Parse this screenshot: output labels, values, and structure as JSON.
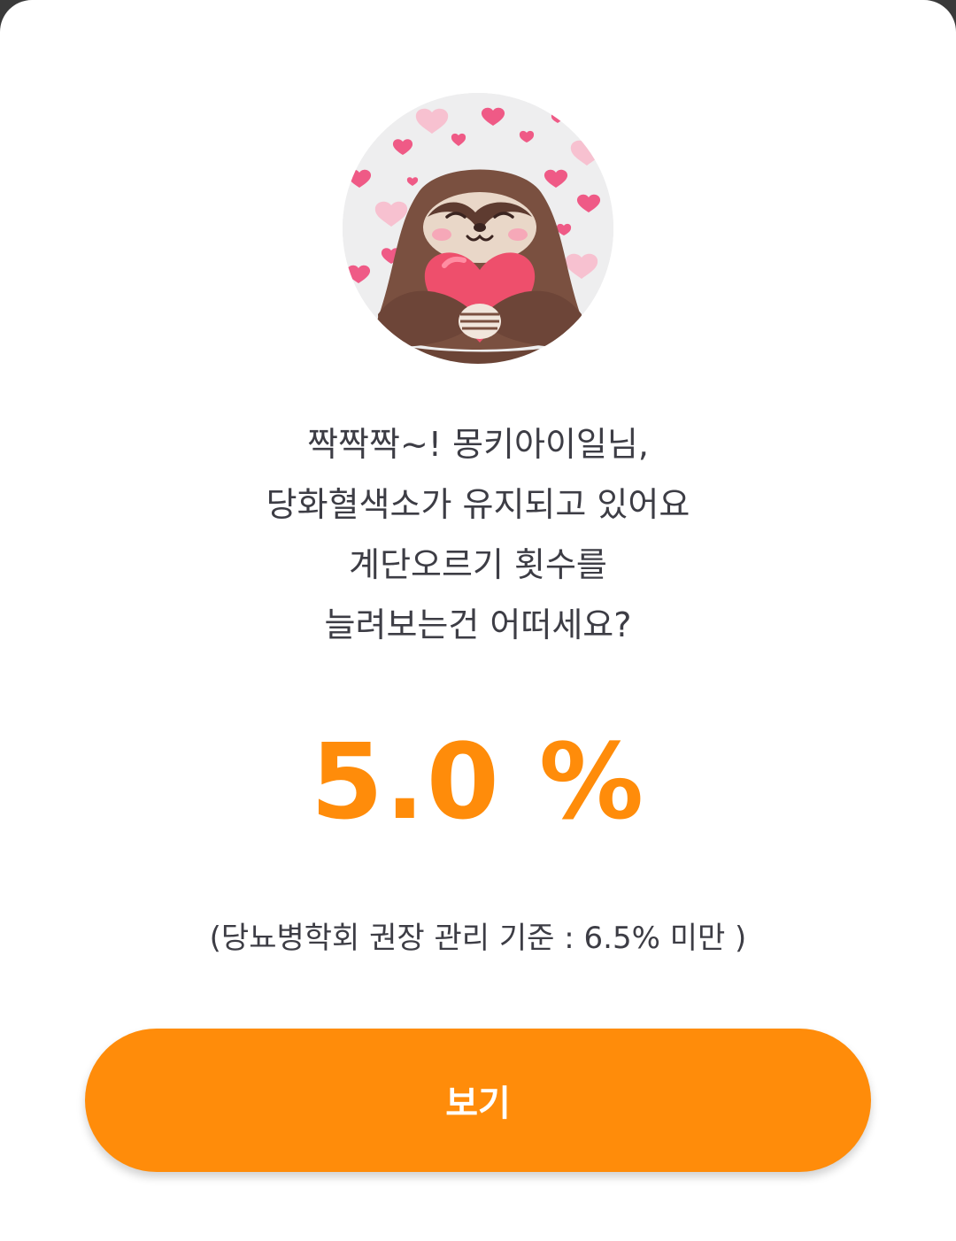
{
  "illustration": {
    "name": "sloth-hugging-heart-illustration"
  },
  "message": {
    "line1": "짝짝짝~! 몽키아이일님,",
    "line2": "당화혈색소가 유지되고 있어요",
    "line3": "계단오르기 횟수를",
    "line4": "늘려보는건 어떠세요?"
  },
  "result": {
    "value": "5.0 %"
  },
  "criteria": {
    "text": "(당뇨병학회 권장 관리 기준 : 6.5% 미만 )"
  },
  "button": {
    "label": "보기"
  },
  "colors": {
    "accent": "#ff8c0a",
    "text": "#3d3d45",
    "background": "#ffffff"
  }
}
